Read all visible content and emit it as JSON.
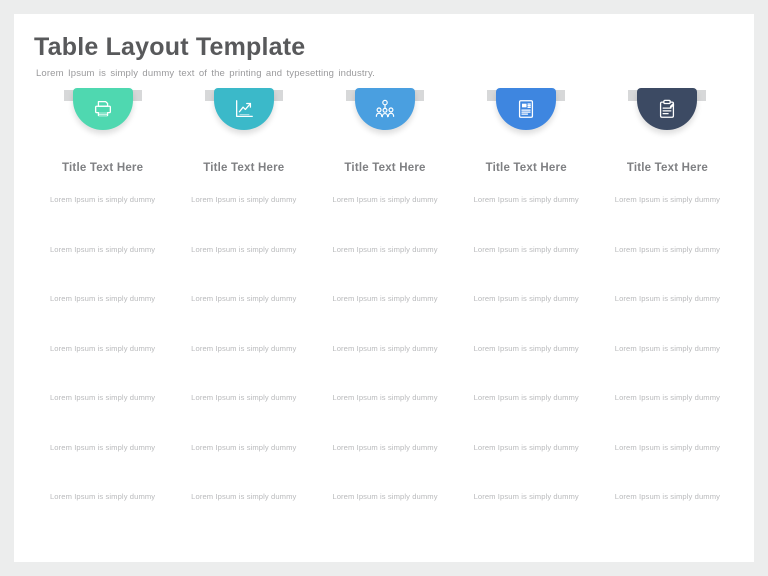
{
  "slide": {
    "title": "Table Layout Template",
    "subtitle": "Lorem Ipsum is simply  dummy  text of the printing and typesetting industry."
  },
  "colors": {
    "background": "#eceded",
    "card": "#ffffff",
    "title_text": "#58595b",
    "subtitle_text": "#9a9a9c",
    "column_title_text": "#7f8083",
    "cell_text": "#b9babc",
    "ribbon": "#d7d8d9"
  },
  "columns": [
    {
      "icon": "printer-icon",
      "color": "#4fd8b0",
      "title": "Title Text Here",
      "cells": [
        "Lorem Ipsum is simply dummy",
        "Lorem Ipsum is simply dummy",
        "Lorem Ipsum is simply dummy",
        "Lorem Ipsum is simply dummy",
        "Lorem Ipsum is simply dummy",
        "Lorem Ipsum is simply dummy",
        "Lorem Ipsum is simply dummy"
      ]
    },
    {
      "icon": "growth-chart-icon",
      "color": "#3bb9c9",
      "title": "Title Text Here",
      "cells": [
        "Lorem Ipsum is simply dummy",
        "Lorem Ipsum is simply dummy",
        "Lorem Ipsum is simply dummy",
        "Lorem Ipsum is simply dummy",
        "Lorem Ipsum is simply dummy",
        "Lorem Ipsum is simply dummy",
        "Lorem Ipsum is simply dummy"
      ]
    },
    {
      "icon": "presentation-team-icon",
      "color": "#4a9fe0",
      "title": "Title Text Here",
      "cells": [
        "Lorem Ipsum is simply dummy",
        "Lorem Ipsum is simply dummy",
        "Lorem Ipsum is simply dummy",
        "Lorem Ipsum is simply dummy",
        "Lorem Ipsum is simply dummy",
        "Lorem Ipsum is simply dummy",
        "Lorem Ipsum is simply dummy"
      ]
    },
    {
      "icon": "document-article-icon",
      "color": "#3e86e0",
      "title": "Title Text Here",
      "cells": [
        "Lorem Ipsum is simply dummy",
        "Lorem Ipsum is simply dummy",
        "Lorem Ipsum is simply dummy",
        "Lorem Ipsum is simply dummy",
        "Lorem Ipsum is simply dummy",
        "Lorem Ipsum is simply dummy",
        "Lorem Ipsum is simply dummy"
      ]
    },
    {
      "icon": "clipboard-pen-icon",
      "color": "#3c4a63",
      "title": "Title Text Here",
      "cells": [
        "Lorem Ipsum is simply dummy",
        "Lorem Ipsum is simply dummy",
        "Lorem Ipsum is simply dummy",
        "Lorem Ipsum is simply dummy",
        "Lorem Ipsum is simply dummy",
        "Lorem Ipsum is simply dummy",
        "Lorem Ipsum is simply dummy"
      ]
    }
  ]
}
